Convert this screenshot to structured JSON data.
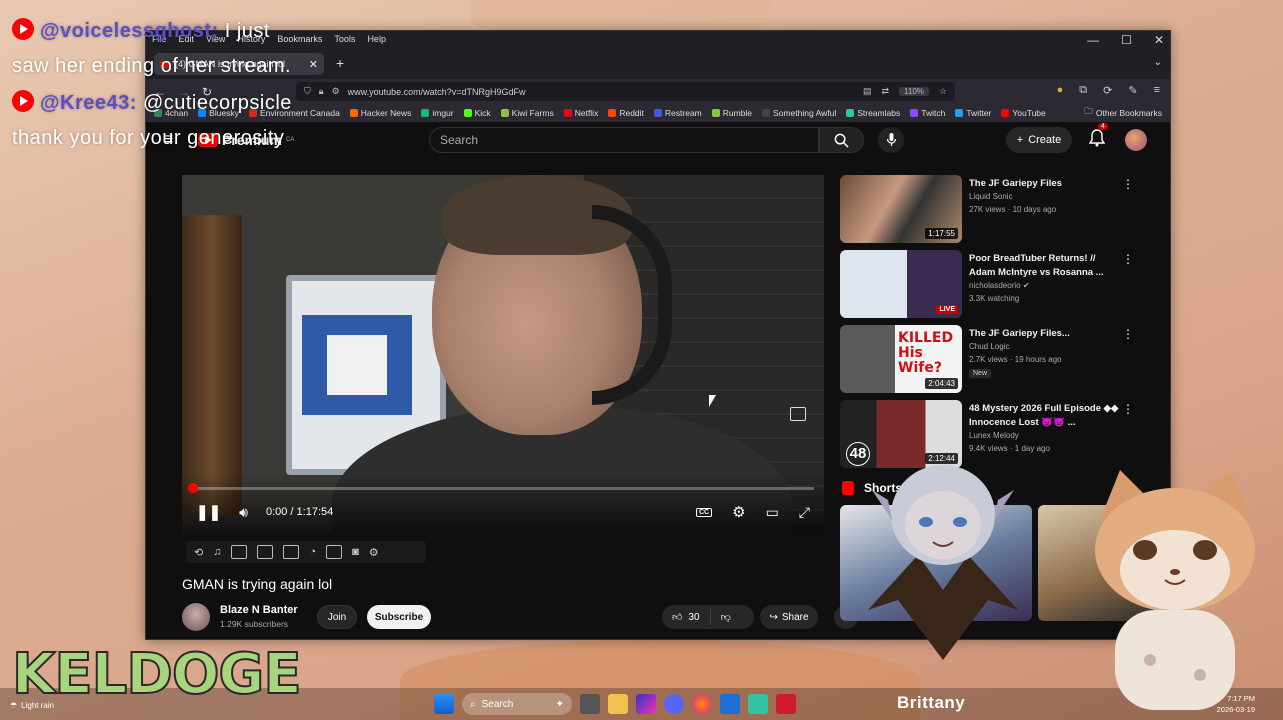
{
  "chat": [
    {
      "user": "@voicelessghost:",
      "text": " I just saw her ending of her stream."
    },
    {
      "user": "@Kree43:",
      "text": " @cutiecorpsicle thank you for your generosity"
    }
  ],
  "browser": {
    "menu": [
      "File",
      "Edit",
      "View",
      "History",
      "Bookmarks",
      "Tools",
      "Help"
    ],
    "tab_title": "(4) GMAN is trying again lol",
    "url": "www.youtube.com/watch?v=dTNRgH9GdFw",
    "zoom": "110%",
    "bookmarks": [
      {
        "label": "4chan",
        "color": "#2e8b57"
      },
      {
        "label": "Bluesky",
        "color": "#1185fe"
      },
      {
        "label": "Environment Canada",
        "color": "#d52b1e"
      },
      {
        "label": "Hacker News",
        "color": "#ff6600"
      },
      {
        "label": "imgur",
        "color": "#1bb76e"
      },
      {
        "label": "Kick",
        "color": "#53fc18"
      },
      {
        "label": "Kiwi Farms",
        "color": "#8bc34a"
      },
      {
        "label": "Netflix",
        "color": "#e50914"
      },
      {
        "label": "Reddit",
        "color": "#ff4500"
      },
      {
        "label": "Restream",
        "color": "#3b5bdb"
      },
      {
        "label": "Rumble",
        "color": "#85c742"
      },
      {
        "label": "Something Awful",
        "color": "#444444"
      },
      {
        "label": "Streamlabs",
        "color": "#31c3a2"
      },
      {
        "label": "Twitch",
        "color": "#9146ff"
      },
      {
        "label": "Twitter",
        "color": "#1da1f2"
      },
      {
        "label": "YouTube",
        "color": "#ff0000"
      }
    ],
    "other_bookmarks": "Other Bookmarks"
  },
  "youtube": {
    "logo": "Premium",
    "logo_region": "CA",
    "search_placeholder": "Search",
    "create_label": "Create",
    "notification_count": "4",
    "player": {
      "time": "0:00 / 1:17:54",
      "progress": 0
    },
    "title": "GMAN is trying again lol",
    "channel": {
      "name": "Blaze N Banter",
      "subscribers": "1.29K subscribers"
    },
    "join_label": "Join",
    "subscribe_label": "Subscribe",
    "likes": "30",
    "share_label": "Share",
    "recommendations": [
      {
        "title": "The JF Gariepy Files",
        "channel": "Liquid Sonic",
        "meta": "27K views · 10 days ago",
        "badge": "1:17:55",
        "live": false,
        "new": false
      },
      {
        "title": "Poor BreadTuber Returns! // Adam McIntyre vs Rosanna ...",
        "channel": "nicholasdeorio",
        "meta": "3.3K watching",
        "badge": "LIVE",
        "live": true,
        "new": false,
        "verified": true
      },
      {
        "title": "The JF Gariepy Files...",
        "channel": "Chud Logic",
        "meta": "2.7K views · 19 hours ago",
        "badge": "2:04:43",
        "live": false,
        "new": true,
        "new_label": "New",
        "thumb_text": "KILLED His Wife?"
      },
      {
        "title": "48 Mystery 2026 Full Episode ◆◆ Innocence Lost 👿👿 ...",
        "channel": "Lunex Melody",
        "meta": "9.4K views · 1 day ago",
        "badge": "2:12:44",
        "live": false,
        "new": false,
        "thumb_text": "48"
      }
    ],
    "shorts_label": "Shorts"
  },
  "overlay": {
    "streamer": "KELDOGE"
  },
  "taskbar": {
    "weather": "Light rain",
    "search": "Search",
    "user": "Brittany",
    "time": "7:17 PM",
    "date": "2026-03-19"
  }
}
